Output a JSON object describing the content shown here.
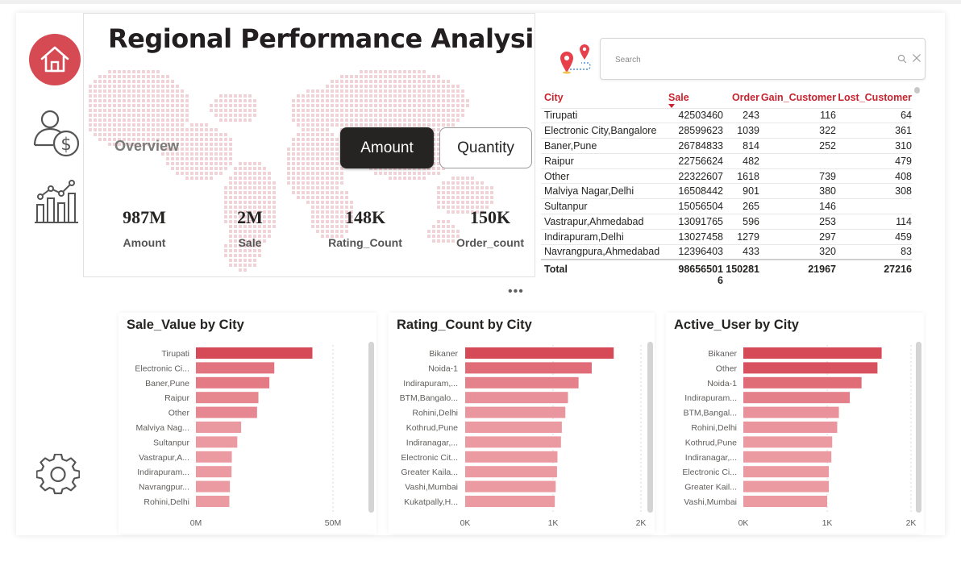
{
  "header": {
    "title": "Regional Performance Analysis"
  },
  "nav": {
    "items": [
      {
        "name": "home",
        "icon": "home-icon",
        "active": true
      },
      {
        "name": "customers",
        "icon": "user-dollar-icon"
      },
      {
        "name": "analytics",
        "icon": "chart-growth-icon"
      },
      {
        "name": "settings",
        "icon": "gear-icon"
      }
    ]
  },
  "overview": {
    "label": "Overview",
    "toggle": {
      "amount": "Amount",
      "quantity": "Quantity",
      "selected": "Amount"
    },
    "kpis": [
      {
        "value": "987M",
        "label": "Amount"
      },
      {
        "value": "2M",
        "label": "Sale"
      },
      {
        "value": "148K",
        "label": "Rating_Count"
      },
      {
        "value": "150K",
        "label": "Order_count"
      }
    ],
    "more": "•••"
  },
  "search": {
    "placeholder": "Search",
    "value": ""
  },
  "table": {
    "columns": [
      "City",
      "Sale",
      "Order",
      "Gain_Customer",
      "Lost_Customer"
    ],
    "sorted_by": "Sale",
    "rows": [
      [
        "Tirupati",
        "42503460",
        "243",
        "116",
        "64"
      ],
      [
        "Electronic City,Bangalore",
        "28599623",
        "1039",
        "322",
        "361"
      ],
      [
        "Baner,Pune",
        "26784833",
        "814",
        "252",
        "310"
      ],
      [
        "Raipur",
        "22756624",
        "482",
        "",
        "479"
      ],
      [
        "Other",
        "22322607",
        "1618",
        "739",
        "408"
      ],
      [
        "Malviya Nagar,Delhi",
        "16508442",
        "901",
        "380",
        "308"
      ],
      [
        "Sultanpur",
        "15056504",
        "265",
        "146",
        ""
      ],
      [
        "Vastrapur,Ahmedabad",
        "13091765",
        "596",
        "253",
        "114"
      ],
      [
        "Indirapuram,Delhi",
        "13027458",
        "1279",
        "297",
        "459"
      ],
      [
        "Navrangpura,Ahmedabad",
        "12396403",
        "433",
        "320",
        "83"
      ]
    ],
    "total": {
      "label": "Total",
      "sale_line1": "98656501",
      "sale_line2": "6",
      "order": "150281",
      "gain": "21967",
      "lost": "27216"
    }
  },
  "colors": {
    "accent": "#d64a54",
    "bar_dark": "#d64a57",
    "bar_light": "#eb9aa2",
    "header_red": "#c8242f",
    "toggle_dark": "#252423"
  },
  "chart_data": [
    {
      "type": "bar",
      "orientation": "horizontal",
      "title": "Sale_Value by City",
      "categories": [
        "Tirupati",
        "Electronic Ci...",
        "Baner,Pune",
        "Raipur",
        "Other",
        "Malviya Nag...",
        "Sultanpur",
        "Vastrapur,A...",
        "Indirapuram...",
        "Navrangpur...",
        "Rohini,Delhi"
      ],
      "values": [
        42.5,
        28.6,
        26.8,
        22.8,
        22.3,
        16.5,
        15.1,
        13.1,
        13.0,
        12.4,
        12.2
      ],
      "xlim": [
        0,
        50
      ],
      "ticks": [
        {
          "v": 0,
          "label": "0M"
        },
        {
          "v": 50,
          "label": "50M"
        }
      ]
    },
    {
      "type": "bar",
      "orientation": "horizontal",
      "title": "Rating_Count by City",
      "categories": [
        "Bikaner",
        "Noida-1",
        "Indirapuram,...",
        "BTM,Bangalo...",
        "Rohini,Delhi",
        "Kothrud,Pune",
        "Indiranagar,...",
        "Electronic Cit...",
        "Greater Kaila...",
        "Vashi,Mumbai",
        "Kukatpally,H..."
      ],
      "values": [
        1690,
        1440,
        1290,
        1170,
        1140,
        1100,
        1090,
        1050,
        1045,
        1030,
        1020
      ],
      "xlim": [
        0,
        2000
      ],
      "ticks": [
        {
          "v": 0,
          "label": "0K"
        },
        {
          "v": 1000,
          "label": "1K"
        },
        {
          "v": 2000,
          "label": "2K"
        }
      ]
    },
    {
      "type": "bar",
      "orientation": "horizontal",
      "title": "Active_User by City",
      "categories": [
        "Bikaner",
        "Other",
        "Noida-1",
        "Indirapuram...",
        "BTM,Bangal...",
        "Rohini,Delhi",
        "Kothrud,Pune",
        "Indiranagar,...",
        "Electronic Ci...",
        "Greater Kail...",
        "Vashi,Mumbai"
      ],
      "values": [
        1650,
        1600,
        1410,
        1270,
        1140,
        1120,
        1060,
        1050,
        1020,
        1020,
        1000
      ],
      "xlim": [
        0,
        2000
      ],
      "ticks": [
        {
          "v": 0,
          "label": "0K"
        },
        {
          "v": 1000,
          "label": "1K"
        },
        {
          "v": 2000,
          "label": "2K"
        }
      ]
    }
  ]
}
